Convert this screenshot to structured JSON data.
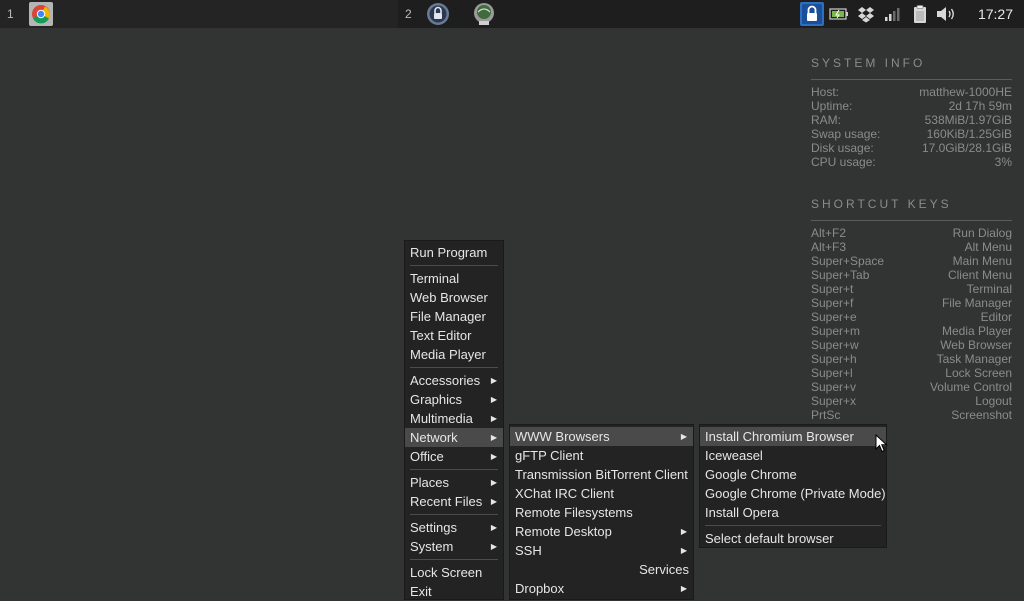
{
  "taskbar": {
    "ws1_num": "1",
    "ws2_num": "2",
    "clock": "17:27",
    "apps": [
      "chrome-icon",
      "lock-icon",
      "screen-icon"
    ],
    "tray": [
      "lock-tray-icon",
      "battery-icon",
      "dropbox-icon",
      "signal-icon",
      "clipboard-icon",
      "volume-icon"
    ]
  },
  "system_info": {
    "title": "SYSTEM INFO",
    "rows": [
      {
        "label": "Host:",
        "value": "matthew-1000HE"
      },
      {
        "label": "Uptime:",
        "value": "2d 17h 59m"
      },
      {
        "label": "RAM:",
        "value": "538MiB/1.97GiB"
      },
      {
        "label": "Swap usage:",
        "value": "160KiB/1.25GiB"
      },
      {
        "label": "Disk usage:",
        "value": "17.0GiB/28.1GiB"
      },
      {
        "label": "CPU usage:",
        "value": "3%"
      }
    ]
  },
  "shortcut_keys": {
    "title": "SHORTCUT KEYS",
    "rows": [
      {
        "key": "Alt+F2",
        "action": "Run Dialog"
      },
      {
        "key": "Alt+F3",
        "action": "Alt Menu"
      },
      {
        "key": "Super+Space",
        "action": "Main Menu"
      },
      {
        "key": "Super+Tab",
        "action": "Client Menu"
      },
      {
        "key": "Super+t",
        "action": "Terminal"
      },
      {
        "key": "Super+f",
        "action": "File Manager"
      },
      {
        "key": "Super+e",
        "action": "Editor"
      },
      {
        "key": "Super+m",
        "action": "Media Player"
      },
      {
        "key": "Super+w",
        "action": "Web Browser"
      },
      {
        "key": "Super+h",
        "action": "Task Manager"
      },
      {
        "key": "Super+l",
        "action": "Lock Screen"
      },
      {
        "key": "Super+v",
        "action": "Volume Control"
      },
      {
        "key": "Super+x",
        "action": "Logout"
      },
      {
        "key": "PrtSc",
        "action": "Screenshot"
      }
    ]
  },
  "main_menu": {
    "run_program": "Run Program",
    "terminal": "Terminal",
    "web_browser": "Web Browser",
    "file_manager": "File Manager",
    "text_editor": "Text Editor",
    "media_player": "Media Player",
    "accessories": "Accessories",
    "graphics": "Graphics",
    "multimedia": "Multimedia",
    "network": "Network",
    "office": "Office",
    "places": "Places",
    "recent_files": "Recent Files",
    "settings": "Settings",
    "system": "System",
    "lock_screen": "Lock Screen",
    "exit": "Exit"
  },
  "network_menu": {
    "www_browsers": "WWW Browsers",
    "gftp": "gFTP Client",
    "transmission": "Transmission BitTorrent Client",
    "xchat": "XChat IRC Client",
    "remote_fs": "Remote Filesystems",
    "remote_desktop": "Remote Desktop",
    "ssh": "SSH",
    "services": "Services",
    "dropbox": "Dropbox"
  },
  "browsers_menu": {
    "install_chromium": "Install Chromium Browser",
    "iceweasel": "Iceweasel",
    "google_chrome": "Google Chrome",
    "google_chrome_private": "Google Chrome (Private Mode)",
    "install_opera": "Install Opera",
    "select_default": "Select default browser"
  },
  "submenu_arrow": "▶"
}
